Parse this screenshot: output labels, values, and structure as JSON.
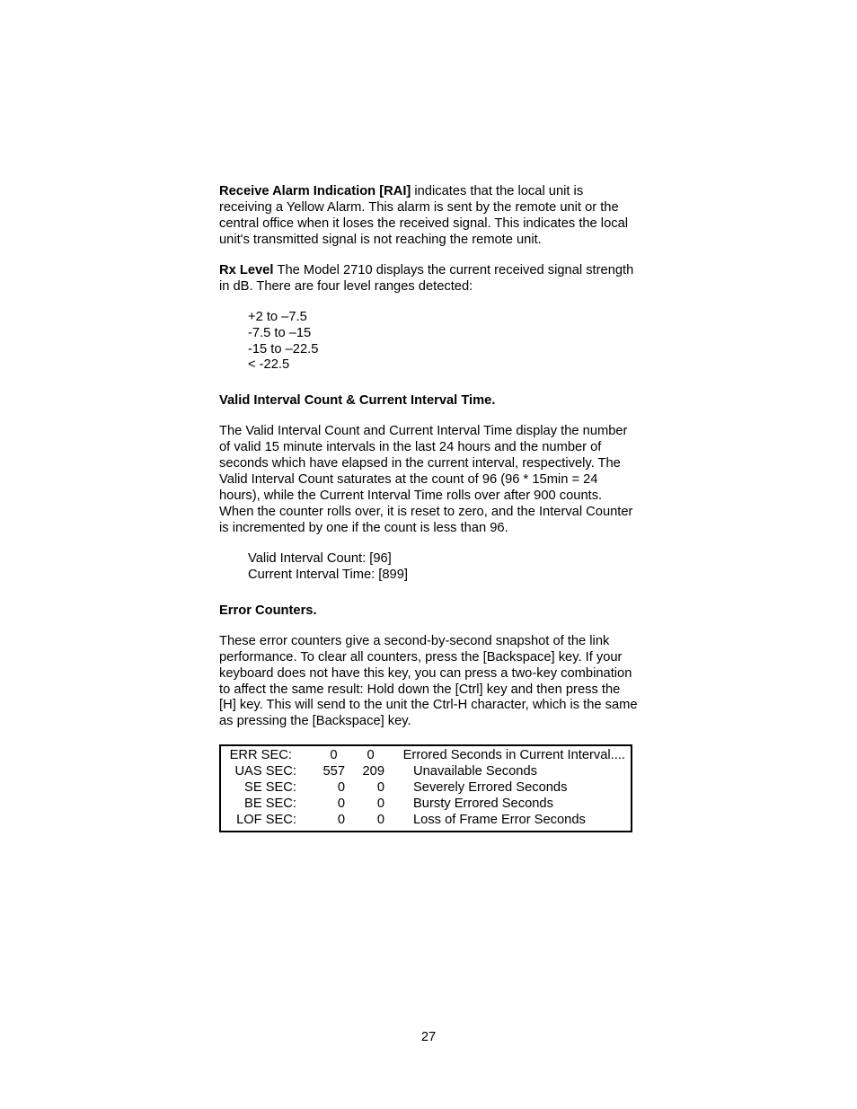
{
  "p1": {
    "lead": "Receive Alarm Indication [RAI] ",
    "rest": " indicates that the local unit is receiving a Yellow Alarm. This alarm is sent by the remote unit or the central office when it loses the received signal. This indicates the local unit's transmitted signal is not reaching the remote unit."
  },
  "p2": {
    "lead": "Rx Level ",
    "rest": " The Model 2710 displays the current received signal strength in dB. There are four level ranges detected:"
  },
  "rx_levels": {
    "l1": "+2 to –7.5",
    "l2": "-7.5 to –15",
    "l3": "-15 to –22.5",
    "l4": "< -22.5"
  },
  "h1": "Valid Interval Count & Current Interval Time.",
  "p3": "The Valid Interval Count and Current Interval Time display the number of valid 15 minute intervals in the last 24 hours and the number of seconds which have elapsed in the current interval, respectively. The Valid Interval Count saturates at the count of 96 (96 * 15min = 24 hours), while the Current Interval Time rolls over after 900 counts. When the counter rolls over, it is reset to zero, and the Interval Counter is incremented by one if the count is less than 96.",
  "interval_values": {
    "line1": "Valid Interval Count:   [96]",
    "line2": "Current Interval Time: [899]"
  },
  "h2": "Error Counters.",
  "p4": "These error counters give a second-by-second snapshot of the link performance. To clear all counters, press the [Backspace] key. If your keyboard does not have this key, you can press a two-key combination to affect the same result: Hold down the [Ctrl] key and then press the [H] key. This will send to the unit the Ctrl-H character, which is the same as pressing the [Backspace] key.",
  "error_table": {
    "rows": [
      {
        "label": "ERR SEC:",
        "v1": "0",
        "v2": "0",
        "desc": "Errored Seconds in Current Interval...."
      },
      {
        "label": "UAS SEC:",
        "v1": "557",
        "v2": "209",
        "desc": "Unavailable Seconds"
      },
      {
        "label": "SE SEC:",
        "v1": "0",
        "v2": "0",
        "desc": "Severely Errored Seconds"
      },
      {
        "label": "BE SEC:",
        "v1": "0",
        "v2": "0",
        "desc": "Bursty Errored Seconds"
      },
      {
        "label": "LOF SEC:",
        "v1": "0",
        "v2": "0",
        "desc": "Loss of Frame Error Seconds"
      }
    ]
  },
  "page_number": "27"
}
